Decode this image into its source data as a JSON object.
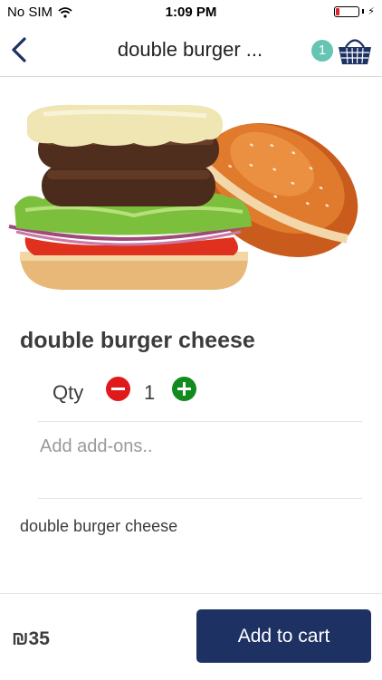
{
  "status_bar": {
    "carrier": "No SIM",
    "time": "1:09 PM"
  },
  "nav": {
    "title": "double burger ...",
    "cart_count": "1"
  },
  "product": {
    "title": "double burger cheese",
    "qty_label": "Qty",
    "quantity": "1",
    "addons_placeholder": "Add add-ons..",
    "description": "double burger cheese"
  },
  "footer": {
    "price": "₪35",
    "add_to_cart_label": "Add to cart"
  },
  "colors": {
    "primary": "#1d3163",
    "badge": "#66c4b3",
    "minus": "#e0191b",
    "plus": "#118a1e"
  },
  "icons": [
    "wifi-icon",
    "battery-icon",
    "back-chevron-icon",
    "basket-icon",
    "minus-icon",
    "plus-icon"
  ]
}
